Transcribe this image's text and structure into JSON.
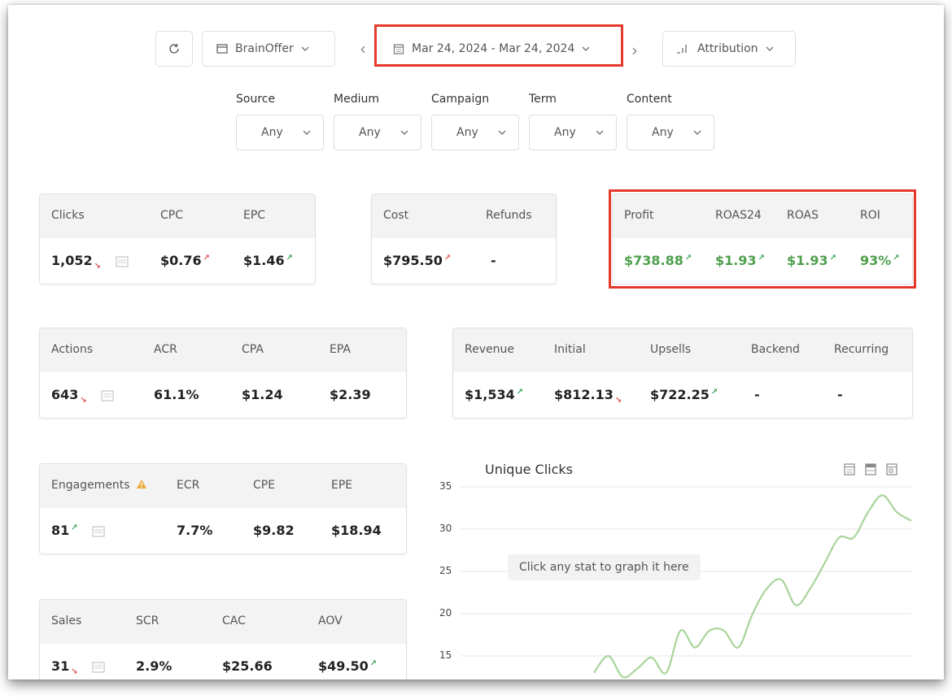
{
  "toolbar": {
    "offer": "BrainOffer",
    "date_range": "Mar 24, 2024 - Mar 24, 2024",
    "attribution": "Attribution"
  },
  "filters": [
    {
      "label": "Source",
      "value": "Any"
    },
    {
      "label": "Medium",
      "value": "Any"
    },
    {
      "label": "Campaign",
      "value": "Any"
    },
    {
      "label": "Term",
      "value": "Any"
    },
    {
      "label": "Content",
      "value": "Any"
    }
  ],
  "cards": {
    "traffic": {
      "headers": [
        "Clicks",
        "CPC",
        "EPC"
      ],
      "values": [
        "1,052",
        "$0.76",
        "$1.46"
      ]
    },
    "cost": {
      "headers": [
        "Cost",
        "Refunds"
      ],
      "values": [
        "$795.50",
        "-"
      ]
    },
    "profit": {
      "headers": [
        "Profit",
        "ROAS24",
        "ROAS",
        "ROI"
      ],
      "values": [
        "$738.88",
        "$1.93",
        "$1.93",
        "93%"
      ]
    },
    "actions": {
      "headers": [
        "Actions",
        "ACR",
        "CPA",
        "EPA"
      ],
      "values": [
        "643",
        "61.1%",
        "$1.24",
        "$2.39"
      ]
    },
    "revenue": {
      "headers": [
        "Revenue",
        "Initial",
        "Upsells",
        "Backend",
        "Recurring"
      ],
      "values": [
        "$1,534",
        "$812.13",
        "$722.25",
        "-",
        "-"
      ]
    },
    "engagements": {
      "headers": [
        "Engagements",
        "ECR",
        "CPE",
        "EPE"
      ],
      "values": [
        "81",
        "7.7%",
        "$9.82",
        "$18.94"
      ]
    },
    "sales": {
      "headers": [
        "Sales",
        "SCR",
        "CAC",
        "AOV"
      ],
      "values": [
        "31",
        "2.9%",
        "$25.66",
        "$49.50"
      ]
    }
  },
  "chart_data": {
    "type": "line",
    "title": "Unique Clicks",
    "hint": "Click any stat to graph it here",
    "ylim": [
      12,
      35
    ],
    "yticks": [
      35,
      30,
      25,
      20,
      15
    ],
    "grid": true,
    "color": "#a8d49a",
    "series": [
      {
        "values": [
          13,
          15,
          12.5,
          13.5,
          14.8,
          13,
          18,
          16,
          18,
          18,
          16,
          20,
          23,
          24,
          21,
          23,
          26,
          29,
          29,
          32,
          34,
          32,
          31
        ]
      }
    ]
  },
  "colors": {
    "highlight": "#e5392b",
    "positive": "#4ea04e",
    "negative": "#e05050"
  }
}
